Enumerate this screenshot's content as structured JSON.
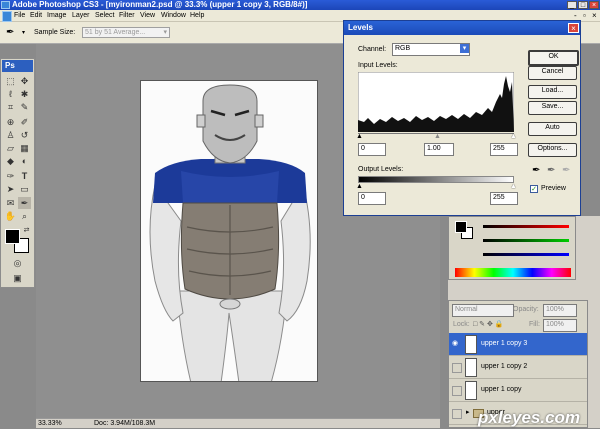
{
  "window": {
    "title": "Adobe Photoshop CS3 - [myironman2.psd @ 33.3% (upper 1 copy 3, RGB/8#)]"
  },
  "menu": [
    "File",
    "Edit",
    "Image",
    "Layer",
    "Select",
    "Filter",
    "View",
    "Window",
    "Help"
  ],
  "options": {
    "sample_size_label": "Sample Size:",
    "sample_size_value": "51 by 51 Average..."
  },
  "toolbox": {
    "logo": "Ps"
  },
  "status": {
    "zoom": "33.33%",
    "doc": "Doc: 3.94M/108.3M"
  },
  "levels": {
    "title": "Levels",
    "channel_label": "Channel:",
    "channel_value": "RGB",
    "input_label": "Input Levels:",
    "input_values": [
      "0",
      "1.00",
      "255"
    ],
    "output_label": "Output Levels:",
    "output_values": [
      "0",
      "255"
    ],
    "buttons": [
      "OK",
      "Cancel",
      "Load...",
      "Save...",
      "Auto",
      "Options..."
    ],
    "preview_label": "Preview",
    "preview_checked": true
  },
  "layers": {
    "blend_mode": "Normal",
    "opacity_label": "Opacity:",
    "opacity_value": "100%",
    "lock_label": "Lock:",
    "fill_label": "Fill:",
    "fill_value": "100%",
    "rows": [
      {
        "name": "upper 1 copy 3",
        "selected": true,
        "visible": true
      },
      {
        "name": "upper 1 copy 2",
        "selected": false,
        "visible": false
      },
      {
        "name": "upper 1 copy",
        "selected": false,
        "visible": false
      },
      {
        "name": "upper",
        "selected": false,
        "visible": false
      }
    ]
  },
  "watermark": "pxleyes.com",
  "colors": {
    "selection": "#3366cc",
    "armor_blue": "#1c3a99",
    "title_blue": "#1c46b8"
  }
}
